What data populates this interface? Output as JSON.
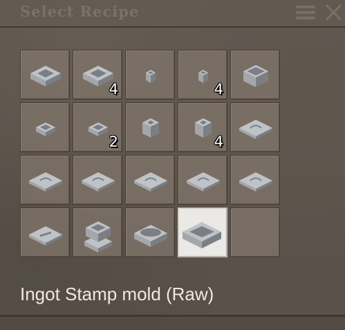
{
  "dialog": {
    "title": "Select Recipe",
    "selected_recipe_name": "Ingot Stamp mold (Raw)"
  },
  "icons": {
    "menu": "hamburger-menu-icon",
    "close": "close-x-icon"
  },
  "recipes": [
    {
      "icon": "large-mold-icon",
      "count": "",
      "selected": false
    },
    {
      "icon": "large-mold-icon",
      "count": "4",
      "selected": false
    },
    {
      "icon": "small-crucible-icon",
      "count": "",
      "selected": false
    },
    {
      "icon": "small-crucible-icon",
      "count": "4",
      "selected": false
    },
    {
      "icon": "deep-crucible-icon",
      "count": "",
      "selected": false
    },
    {
      "icon": "flat-mold-icon",
      "count": "",
      "selected": false
    },
    {
      "icon": "flat-mold-icon",
      "count": "2",
      "selected": false
    },
    {
      "icon": "cube-vessel-icon",
      "count": "",
      "selected": false
    },
    {
      "icon": "cube-vessel-icon",
      "count": "4",
      "selected": false
    },
    {
      "icon": "stamp-plate-icon",
      "count": "",
      "selected": false
    },
    {
      "icon": "stamp-plate-icon",
      "count": "",
      "selected": false
    },
    {
      "icon": "stamp-plate-icon",
      "count": "",
      "selected": false
    },
    {
      "icon": "stamp-plate-icon",
      "count": "",
      "selected": false
    },
    {
      "icon": "stamp-plate-icon",
      "count": "",
      "selected": false
    },
    {
      "icon": "stamp-plate-icon",
      "count": "",
      "selected": false
    },
    {
      "icon": "bar-plate-icon",
      "count": "",
      "selected": false
    },
    {
      "icon": "stacked-mold-icon",
      "count": "",
      "selected": false
    },
    {
      "icon": "oval-mold-icon",
      "count": "",
      "selected": false
    },
    {
      "icon": "ingot-stamp-mold-icon",
      "count": "",
      "selected": true
    },
    {
      "icon": "empty-slot",
      "count": "",
      "selected": false
    }
  ],
  "colors": {
    "selected_slot": "#ebe9e6",
    "clay_light": "#bfc2c6",
    "clay_mid": "#a3a6aa",
    "clay_dark": "#7b7e82"
  }
}
